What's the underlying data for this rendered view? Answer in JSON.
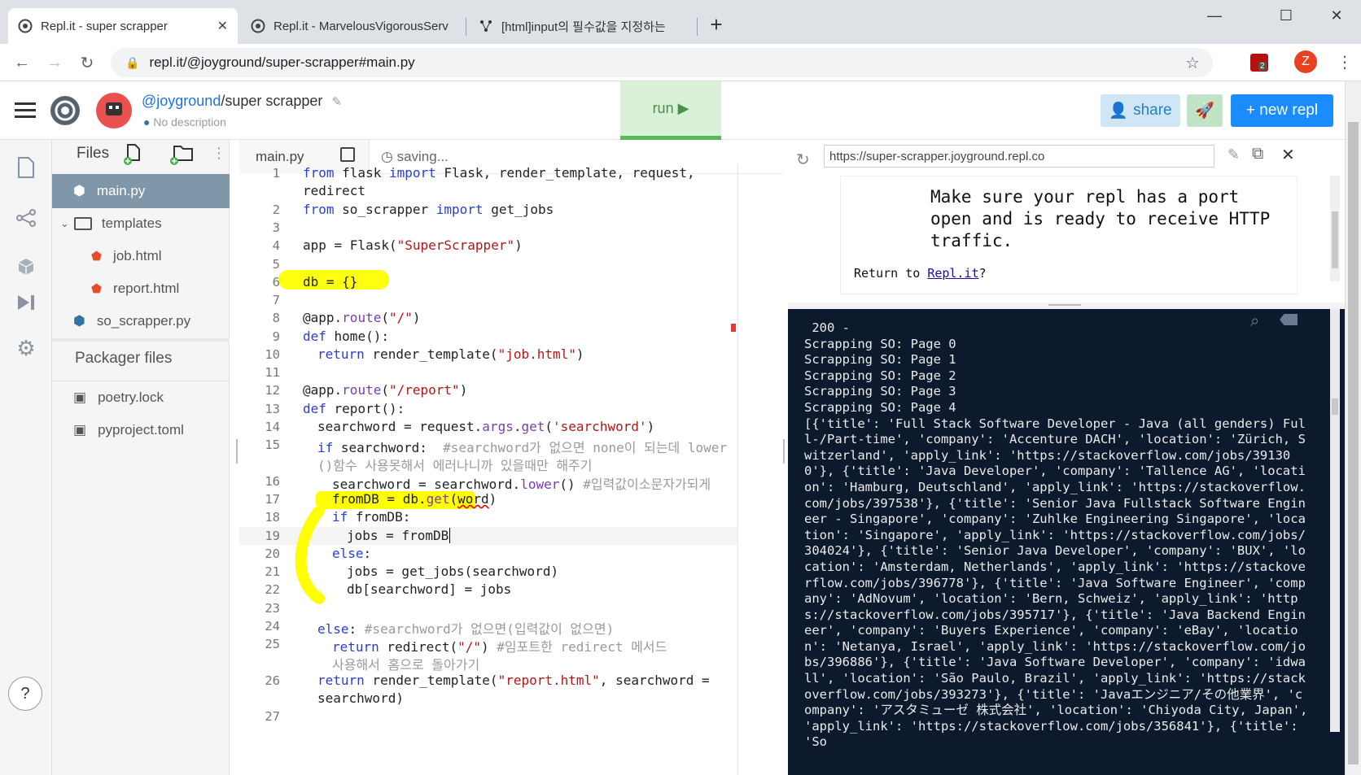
{
  "browser": {
    "tabs": [
      {
        "title": "Repl.it - super scrapper",
        "active": true
      },
      {
        "title": "Repl.it - MarvelousVigorousServ",
        "active": false
      },
      {
        "title": "[html]input의 필수값을 지정하는",
        "active": false
      }
    ],
    "new_tab": "+",
    "address": "repl.it/@joyground/super-scrapper#main.py",
    "profile_initial": "Z",
    "ext_badge": "2"
  },
  "repl": {
    "owner": "@joyground",
    "separator": "/",
    "name": "super scrapper",
    "description": "No description",
    "run_label": "run ▶",
    "share_label": "share",
    "new_repl_label": "+ new repl"
  },
  "files": {
    "header": "Files",
    "items": [
      {
        "name": "main.py"
      },
      {
        "name": "templates"
      },
      {
        "name": "job.html"
      },
      {
        "name": "report.html"
      },
      {
        "name": "so_scrapper.py"
      }
    ],
    "packager_header": "Packager files",
    "packager_items": [
      {
        "name": "poetry.lock"
      },
      {
        "name": "pyproject.toml"
      }
    ],
    "help": "?"
  },
  "editor": {
    "tab_name": "main.py",
    "status": "saving...",
    "line_numbers": [
      "1",
      "2",
      "3",
      "4",
      "5",
      "6",
      "7",
      "8",
      "9",
      "10",
      "11",
      "12",
      "13",
      "14",
      "15",
      "16",
      "17",
      "18",
      "19",
      "20",
      "21",
      "22",
      "23",
      "24",
      "25",
      "26",
      "27"
    ]
  },
  "webview": {
    "url": "https://super-scrapper.joyground.repl.co",
    "message": "Make sure your repl has a port open and is ready to receive HTTP traffic.",
    "return_prefix": "Return to ",
    "return_link": "Repl.it",
    "return_suffix": "?"
  },
  "console": {
    "output": " 200 -\nScrapping SO: Page 0\nScrapping SO: Page 1\nScrapping SO: Page 2\nScrapping SO: Page 3\nScrapping SO: Page 4\n[{'title': 'Full Stack Software Developer - Java (all genders) Full-/Part-time', 'company': 'Accenture DACH', 'location': 'Zürich, Switzerland', 'apply_link': 'https://stackoverflow.com/jobs/391300'}, {'title': 'Java Developer', 'company': 'Tallence AG', 'location': 'Hamburg, Deutschland', 'apply_link': 'https://stackoverflow.com/jobs/397538'}, {'title': 'Senior Java Fullstack Software Engineer - Singapore', 'company': 'Zuhlke Engineering Singapore', 'location': 'Singapore', 'apply_link': 'https://stackoverflow.com/jobs/304024'}, {'title': 'Senior Java Developer', 'company': 'BUX', 'location': 'Amsterdam, Netherlands', 'apply_link': 'https://stackoverflow.com/jobs/396778'}, {'title': 'Java Software Engineer', 'company': 'AdNovum', 'location': 'Bern, Schweiz', 'apply_link': 'https://stackoverflow.com/jobs/395717'}, {'title': 'Java Backend Engineer', 'company': 'Buyers Experience', 'company': 'eBay', 'location': 'Netanya, Israel', 'apply_link': 'https://stackoverflow.com/jobs/396886'}, {'title': 'Java Software Developer', 'company': 'idwall', 'location': 'São Paulo, Brazil', 'apply_link': 'https://stackoverflow.com/jobs/393273'}, {'title': 'Javaエンジニア/その他業界', 'company': 'アスタミューゼ 株式会社', 'location': 'Chiyoda City, Japan', 'apply_link': 'https://stackoverflow.com/jobs/356841'}, {'title': 'So"
  },
  "code": {
    "l1a": "from",
    "l1b": " flask ",
    "l1c": "import",
    "l1d": " Flask, render_template, request,",
    "l1e": "redirect",
    "l2a": "from",
    "l2b": " so_scrapper ",
    "l2c": "import",
    "l2d": " get_jobs",
    "l4a": "app = Flask(",
    "l4b": "\"SuperScrapper\"",
    "l4c": ")",
    "l6": "db = {}",
    "l8a": "@app.",
    "l8b": "route",
    "l8c": "(",
    "l8d": "\"/\"",
    "l8e": ")",
    "l9a": "def",
    "l9b": " home():",
    "l10a": "return",
    "l10b": " render_template(",
    "l10c": "\"job.html\"",
    "l10d": ")",
    "l12a": "@app.",
    "l12b": "route",
    "l12c": "(",
    "l12d": "\"/report\"",
    "l12e": ")",
    "l13a": "def",
    "l13b": " report():",
    "l14a": "searchword = request.",
    "l14b": "args",
    "l14c": ".",
    "l14d": "get",
    "l14e": "(",
    "l14f": "'searchword'",
    "l14g": ")",
    "l15a": "if",
    "l15b": " searchword:  ",
    "l15c": "#searchword가 없으면 none이 되는데 lower",
    "l15d": "()함수 사용못해서 에러나니까 있을때만 해주기",
    "l16a": "searchword = searchword.",
    "l16b": "lower",
    "l16c": "() ",
    "l16d": "#입력값이소문자가되게",
    "l17a": "fromDB = db.",
    "l17b": "get",
    "l17c": "(",
    "l17d": "word",
    "l17e": ")",
    "l18a": "if",
    "l18b": " fromDB:",
    "l19": "jobs = fromDB",
    "l20a": "else",
    "l20b": ":",
    "l21": "jobs = get_jobs(searchword)",
    "l22": "db[searchword] = jobs",
    "l24a": "else",
    "l24b": ": ",
    "l24c": "#searchword가 없으면(입력값이 없으면)",
    "l25a": "return",
    "l25b": " redirect(",
    "l25c": "\"/\"",
    "l25d": ") ",
    "l25e": "#임포트한 redirect 메서드",
    "l25f": "사용해서 홈으로 돌아가기",
    "l26a": "return",
    "l26b": " render_template(",
    "l26c": "\"report.html\"",
    "l26d": ", searchword =",
    "l26e": "searchword)"
  },
  "colors": {
    "accent": "#1a8cff",
    "run_bg": "#d9f0d9",
    "run_border": "#5cb85c",
    "highlight": "#ffff00",
    "console_bg": "#0d1a2d"
  }
}
